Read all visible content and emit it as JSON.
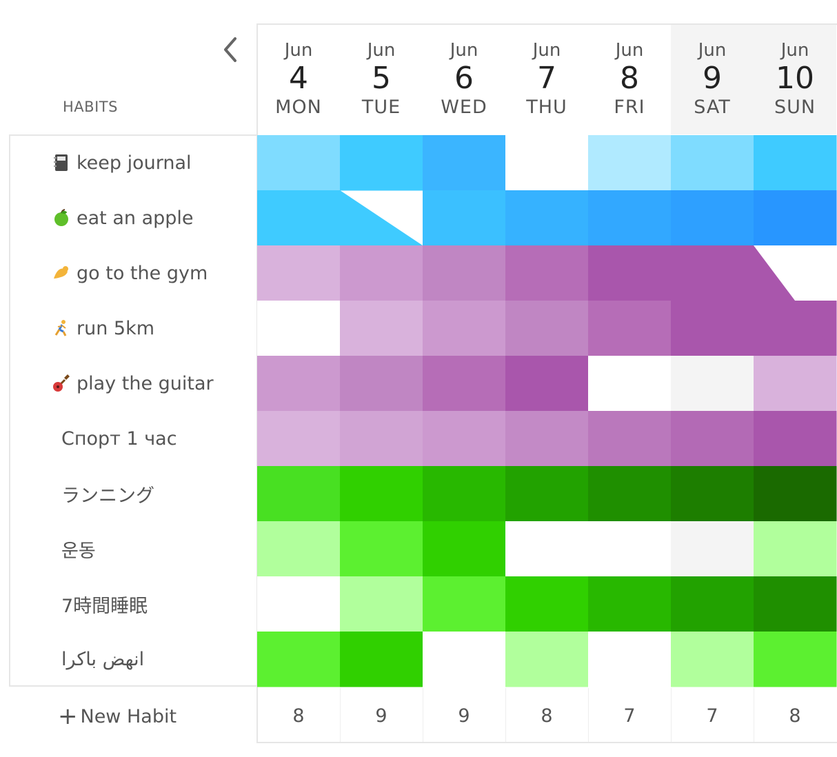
{
  "header": {
    "habits_label": "HABITS",
    "back_icon": "chevron-left-icon"
  },
  "days": [
    {
      "month": "Jun",
      "day": "4",
      "weekday": "MON",
      "weekend": false
    },
    {
      "month": "Jun",
      "day": "5",
      "weekday": "TUE",
      "weekend": false
    },
    {
      "month": "Jun",
      "day": "6",
      "weekday": "WED",
      "weekend": false
    },
    {
      "month": "Jun",
      "day": "7",
      "weekday": "THU",
      "weekend": false
    },
    {
      "month": "Jun",
      "day": "8",
      "weekday": "FRI",
      "weekend": false
    },
    {
      "month": "Jun",
      "day": "9",
      "weekday": "SAT",
      "weekend": true
    },
    {
      "month": "Jun",
      "day": "10",
      "weekday": "SUN",
      "weekend": true
    }
  ],
  "habits": [
    {
      "name": "keep journal",
      "icon": "notebook-icon",
      "cells": [
        "#7fdcff",
        "#3fcbff",
        "#3bb5ff",
        "empty",
        "#b0eaff",
        "#7fdcff",
        "#3fcbff"
      ]
    },
    {
      "name": "eat an apple",
      "icon": "apple-icon",
      "cells": [
        "#3fcbff",
        "partial:#3fcbff",
        "#3bc0ff",
        "#36b2ff",
        "#32a8ff",
        "#2ea0ff",
        "#2896ff"
      ]
    },
    {
      "name": "go to the gym",
      "icon": "muscle-icon",
      "cells": [
        "#d9b2dc",
        "#cc99cf",
        "#c086c3",
        "#b66db7",
        "#a956ac",
        "#a956ac",
        "empty"
      ]
    },
    {
      "name": "run 5km",
      "icon": "runner-icon",
      "cells": [
        "empty",
        "#d9b2dc",
        "#cc99cf",
        "#c086c3",
        "#b66db7",
        "#a956ac",
        "#a956ac"
      ]
    },
    {
      "name": "play the guitar",
      "icon": "guitar-icon",
      "cells": [
        "#cc99cf",
        "#c086c3",
        "#b66db7",
        "#a956ac",
        "empty",
        "weekend",
        "#d9b2dc"
      ]
    },
    {
      "name": "Спорт 1 час",
      "icon": "",
      "cells": [
        "#d9b2dc",
        "#d1a4d4",
        "#cc99cf",
        "#c38ac6",
        "#ba78bc",
        "#b36ab5",
        "#a956ac"
      ]
    },
    {
      "name": "ランニング",
      "icon": "",
      "cells": [
        "#48e022",
        "#30d000",
        "#28b800",
        "#22a200",
        "#1f8f00",
        "#1d7e00",
        "#1a6a00"
      ]
    },
    {
      "name": "운동",
      "icon": "",
      "cells": [
        "#b1ff9c",
        "#5cf030",
        "#30d000",
        "empty",
        "empty",
        "weekend",
        "#b1ff9c"
      ]
    },
    {
      "name": "7時間睡眠",
      "icon": "",
      "cells": [
        "empty",
        "#b1ff9c",
        "#5cf030",
        "#30d000",
        "#28b800",
        "#22a200",
        "#1f8f00"
      ]
    },
    {
      "name": "انهض باكرا",
      "icon": "",
      "cells": [
        "#5cf030",
        "#30d000",
        "empty",
        "#b1ff9c",
        "empty",
        "#b1ff9c",
        "#5cf030"
      ]
    }
  ],
  "new_habit": {
    "label": "New Habit",
    "icon": "plus-icon"
  },
  "totals": [
    "8",
    "9",
    "9",
    "8",
    "7",
    "7",
    "8"
  ],
  "colors": {
    "weekend_bg": "#f4f4f4",
    "border": "#e6e6e6"
  }
}
